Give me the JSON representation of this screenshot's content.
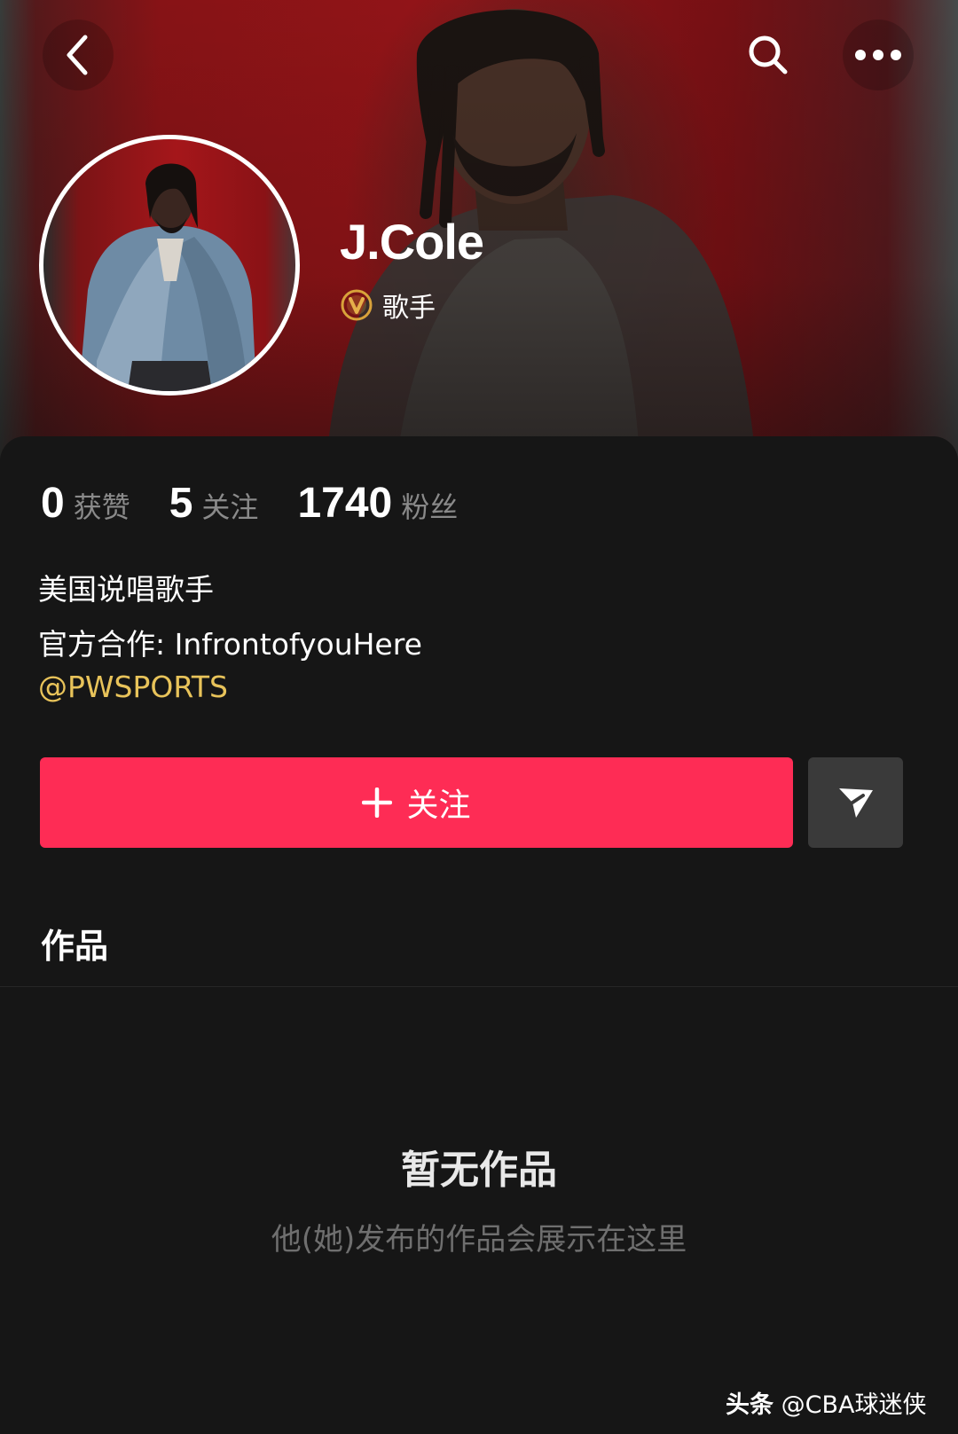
{
  "header": {
    "back_icon": "chevron-left-icon",
    "search_icon": "search-icon",
    "more_icon": "more-horizontal-icon"
  },
  "profile": {
    "name": "J.Cole",
    "verified_icon": "verified-v-badge-icon",
    "verified_color": "#d9a23a",
    "category": "歌手"
  },
  "stats": [
    {
      "value": "0",
      "label": "获赞"
    },
    {
      "value": "5",
      "label": "关注"
    },
    {
      "value": "1740",
      "label": "粉丝"
    }
  ],
  "bio": {
    "line1": "美国说唱歌手",
    "line2": "官方合作: InfrontofyouHere",
    "mention": "@PWSPORTS",
    "mention_color": "#e8c35a"
  },
  "actions": {
    "follow_label": "关注",
    "follow_color": "#fe2c55",
    "share_icon": "send-icon"
  },
  "tabs": {
    "works": "作品"
  },
  "empty_state": {
    "title": "暂无作品",
    "subtitle": "他(她)发布的作品会展示在这里"
  },
  "watermark": {
    "brand": "头条",
    "handle": "@CBA球迷侠"
  }
}
